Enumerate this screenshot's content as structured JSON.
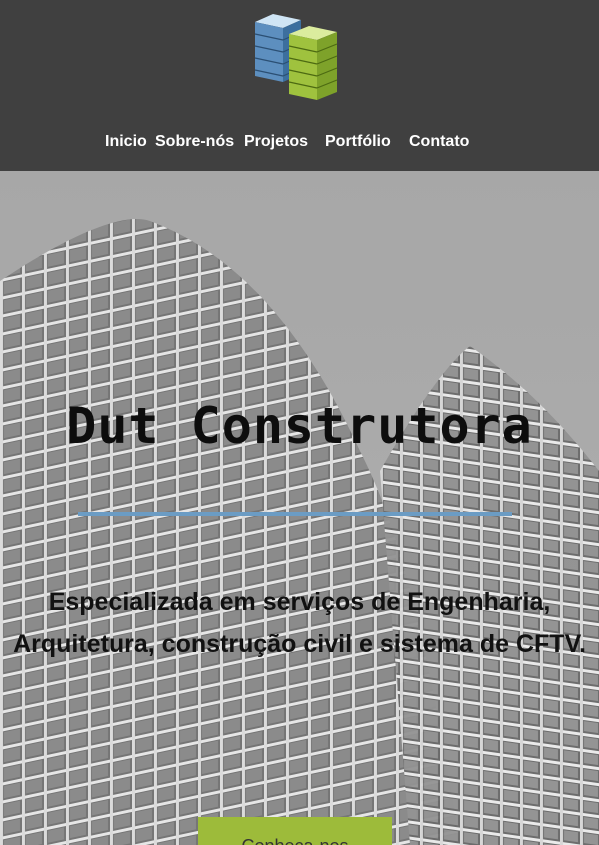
{
  "header": {
    "logo_icon": "stacked-buildings-logo",
    "nav": [
      {
        "label": "Inicio"
      },
      {
        "label": "Sobre-nós"
      },
      {
        "label": "Projetos"
      },
      {
        "label": "Portfólio"
      },
      {
        "label": "Contato"
      }
    ]
  },
  "hero": {
    "background": "grayscale-skyscraper-photo",
    "title": "Dut Construtora",
    "subtitle": "Especializada em serviços de Engenharia, Arquitetura, construção civil e sistema de CFTV.",
    "cta_label": "Conheça-nos"
  },
  "colors": {
    "header_bg": "#404040",
    "divider": "#6b9cc4",
    "cta_bg": "#9dbb3a",
    "logo_blue": "#a9cfe8",
    "logo_green": "#b6d55a"
  }
}
